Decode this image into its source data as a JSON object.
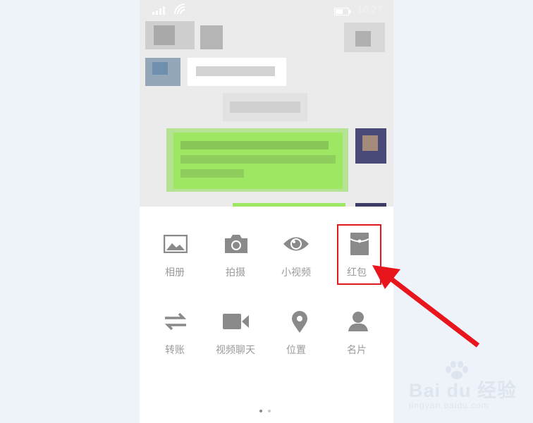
{
  "status_bar": {
    "time": "10:27",
    "icons": [
      "signal-icon",
      "wifi-icon",
      "battery-icon"
    ]
  },
  "panel": {
    "row1": [
      {
        "label": "相册",
        "icon": "album-icon"
      },
      {
        "label": "拍摄",
        "icon": "camera-icon"
      },
      {
        "label": "小视频",
        "icon": "eye-icon"
      },
      {
        "label": "红包",
        "icon": "red-packet-icon"
      }
    ],
    "row2": [
      {
        "label": "转账",
        "icon": "transfer-icon"
      },
      {
        "label": "视频聊天",
        "icon": "video-camera-icon"
      },
      {
        "label": "位置",
        "icon": "location-pin-icon"
      },
      {
        "label": "名片",
        "icon": "contact-card-icon"
      }
    ],
    "page_dots": {
      "count": 2,
      "active": 0
    }
  },
  "colors": {
    "page_background": "#eef2f9",
    "chat_background": "#ebebeb",
    "sent_bubble": "#9ee763",
    "icon_gray": "#8a8a8a",
    "label_gray": "#9a9a9a",
    "annotation_red": "#e0191f"
  },
  "watermark": {
    "title": "Bai du 经验",
    "url": "jingyan.baidu.com"
  }
}
